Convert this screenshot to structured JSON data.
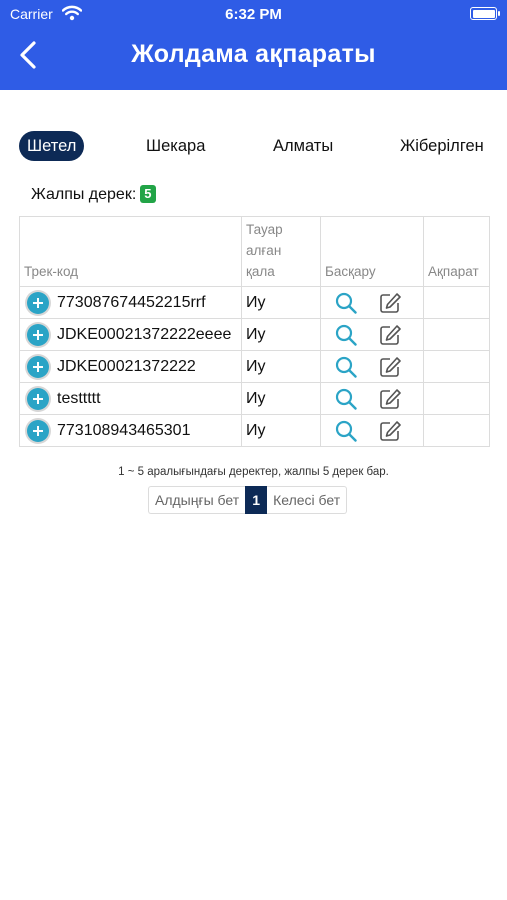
{
  "status_bar": {
    "carrier": "Carrier",
    "time": "6:32 PM"
  },
  "header": {
    "title": "Жолдама ақпараты"
  },
  "tabs": [
    {
      "label": "Шетел",
      "active": true
    },
    {
      "label": "Шекара",
      "active": false
    },
    {
      "label": "Алматы",
      "active": false
    },
    {
      "label": "Жіберілген",
      "active": false
    }
  ],
  "summary": {
    "label": "Жалпы дерек:",
    "count": "5"
  },
  "table": {
    "columns": [
      "Трек-код",
      "Тауар алған қала",
      "Басқару",
      "Ақпарат"
    ],
    "rows": [
      {
        "track": "773087674452215rrf",
        "city": "Иу",
        "info": ""
      },
      {
        "track": "JDKE00021372222eeee",
        "city": "Иу",
        "info": ""
      },
      {
        "track": "JDKE00021372222",
        "city": "Иу",
        "info": ""
      },
      {
        "track": "testtttt",
        "city": "Иу",
        "info": ""
      },
      {
        "track": "773108943465301",
        "city": "Иу",
        "info": ""
      }
    ]
  },
  "pagination": {
    "info": "1 ~ 5 аралығындағы деректер, жалпы 5 дерек бар.",
    "prev": "Алдыңғы бет",
    "current": "1",
    "next": "Келесі бет"
  },
  "colors": {
    "header": "#2f5ce6",
    "active_tab": "#0d2a56",
    "badge": "#22a447",
    "accent_icon": "#2ba4c6"
  },
  "icons": [
    "wifi-icon",
    "battery-icon",
    "back-arrow-icon",
    "plus-circle-icon",
    "search-icon",
    "edit-icon"
  ]
}
